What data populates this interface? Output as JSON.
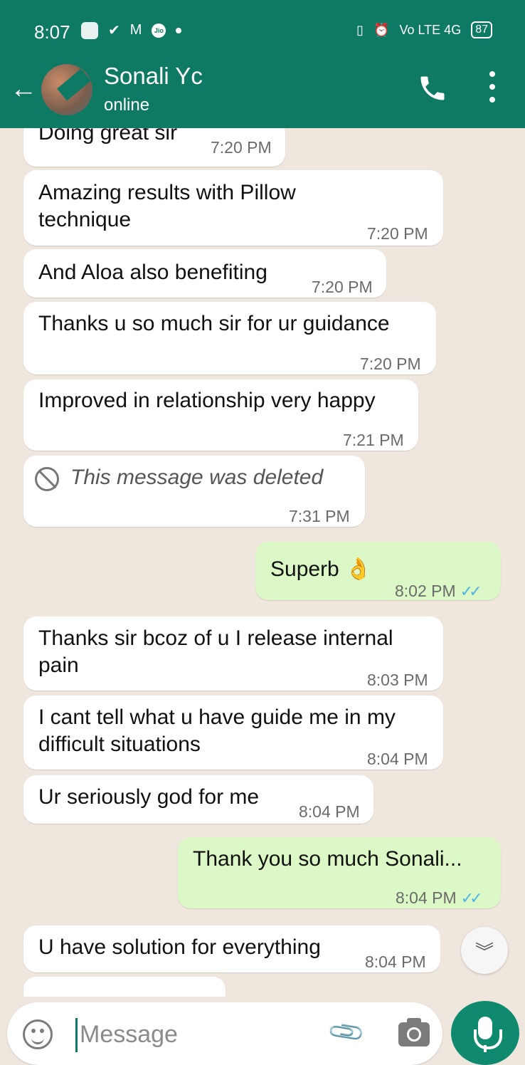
{
  "status_bar": {
    "time": "8:07",
    "signal": "Vo LTE 4G",
    "battery": "87"
  },
  "header": {
    "contact_name": "Sonali Yc",
    "presence": "online"
  },
  "messages": [
    {
      "direction": "in",
      "text": "Doing great sir",
      "time": "7:20 PM"
    },
    {
      "direction": "in",
      "text": "Amazing results with Pillow technique",
      "time": "7:20 PM"
    },
    {
      "direction": "in",
      "text": "And Aloa also benefiting",
      "time": "7:20 PM"
    },
    {
      "direction": "in",
      "text": "Thanks u so much sir for ur guidance",
      "time": "7:20 PM"
    },
    {
      "direction": "in",
      "text": "Improved in relationship very happy",
      "time": "7:21 PM"
    },
    {
      "direction": "in",
      "text": "This message was deleted",
      "time": "7:31 PM",
      "deleted": true
    },
    {
      "direction": "out",
      "text": "Superb 👌",
      "time": "8:02 PM",
      "read": true
    },
    {
      "direction": "in",
      "text": "Thanks sir bcoz of u I release internal pain",
      "time": "8:03 PM"
    },
    {
      "direction": "in",
      "text": "I cant tell what u have guide me in my difficult situations",
      "time": "8:04 PM"
    },
    {
      "direction": "in",
      "text": "Ur seriously god for me",
      "time": "8:04 PM"
    },
    {
      "direction": "out",
      "text": "Thank you so much Sonali...",
      "time": "8:04 PM",
      "read": true
    },
    {
      "direction": "in",
      "text": "U have solution for everything",
      "time": "8:04 PM"
    }
  ],
  "composer": {
    "placeholder": "Message"
  },
  "colors": {
    "header": "#0f7a64",
    "outgoing": "#dcf8c6",
    "incoming": "#ffffff",
    "chat_bg": "#efe7de",
    "read_ticks": "#4fb3e8"
  },
  "icons": [
    "back-arrow-icon",
    "call-icon",
    "more-options-icon",
    "deleted-icon",
    "scroll-down-icon",
    "emoji-icon",
    "attach-icon",
    "camera-icon",
    "mic-icon"
  ]
}
